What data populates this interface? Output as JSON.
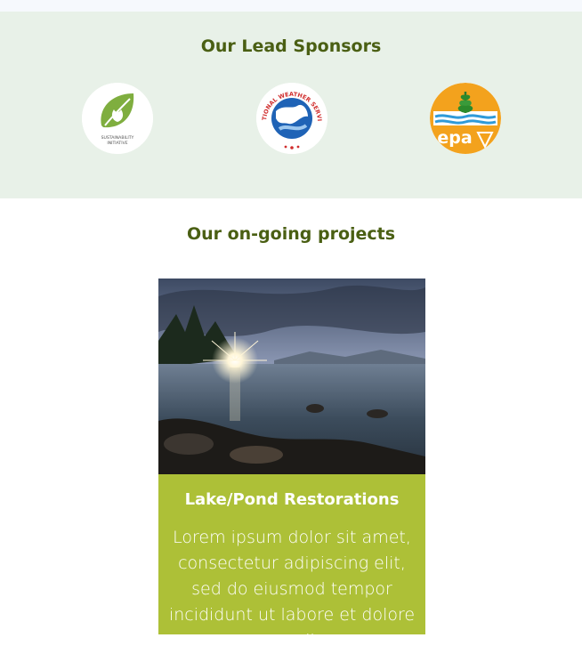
{
  "sponsors": {
    "title": "Our Lead Sponsors",
    "logos": [
      {
        "name": "sustainability-initiative-logo",
        "caption_line1": "SUSTAINABILITY",
        "caption_line2": "INITIATIVE"
      },
      {
        "name": "national-weather-service-logo",
        "arc_text": "NATIONAL WEATHER SERVICE"
      },
      {
        "name": "epa-logo",
        "text": "epa"
      }
    ]
  },
  "projects": {
    "title": "Our on-going projects",
    "items": [
      {
        "name": "Lake/Pond Restorations",
        "description": "Lorem ipsum dolor sit amet, consectetur adipiscing elit, sed do eiusmod tempor incididunt ut labore et dolore magna aliqua."
      }
    ]
  },
  "colors": {
    "heading": "#4a5f13",
    "sponsor_band": "#e8f1e8",
    "card_accent": "#adc037"
  }
}
